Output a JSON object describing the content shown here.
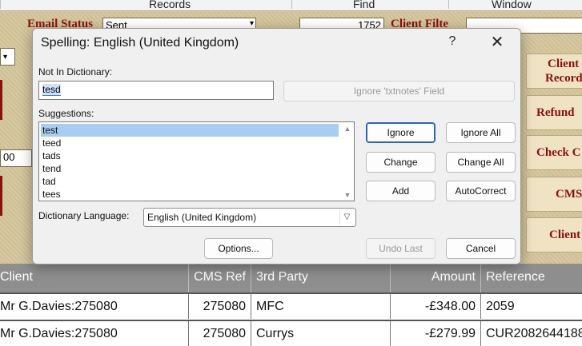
{
  "menubar": {
    "records": "Records",
    "find": "Find",
    "window": "Window"
  },
  "background": {
    "email_status_label": "Email Status",
    "email_status_value": "Sent",
    "number_field": "1752",
    "client_filter_label": "Client Filte",
    "left_value": "00",
    "buttons": {
      "client_records_line1": "Client",
      "client_records_line2": "Records",
      "refund": "Refund",
      "check": "Check C",
      "cms": "CMS",
      "client": "Client"
    }
  },
  "table": {
    "headers": [
      "Client",
      "CMS Ref",
      "3rd Party",
      "Amount",
      "Reference"
    ],
    "rows": [
      [
        "Mr G.Davies:275080",
        "275080",
        "MFC",
        "-£348.00",
        "2059"
      ],
      [
        "Mr G.Davies:275080",
        "275080",
        "Currys",
        "-£279.99",
        "CUR2082644188"
      ]
    ]
  },
  "dialog": {
    "title": "Spelling: English (United Kingdom)",
    "help": "?",
    "close": "✕",
    "not_in_dictionary_label": "Not In Dictionary:",
    "not_in_dictionary_value": "tesd",
    "ignore_field_button": "Ignore 'txtnotes' Field",
    "suggestions_label": "Suggestions:",
    "suggestions": [
      "test",
      "teed",
      "tads",
      "tend",
      "tad",
      "tees"
    ],
    "selected_suggestion": "test",
    "buttons": {
      "ignore": "Ignore",
      "ignore_all": "Ignore All",
      "change": "Change",
      "change_all": "Change All",
      "add": "Add",
      "autocorrect": "AutoCorrect",
      "options": "Options...",
      "undo_last": "Undo Last",
      "cancel": "Cancel"
    },
    "dictionary_language_label": "Dictionary Language:",
    "dictionary_language_value": "English (United Kingdom)"
  }
}
